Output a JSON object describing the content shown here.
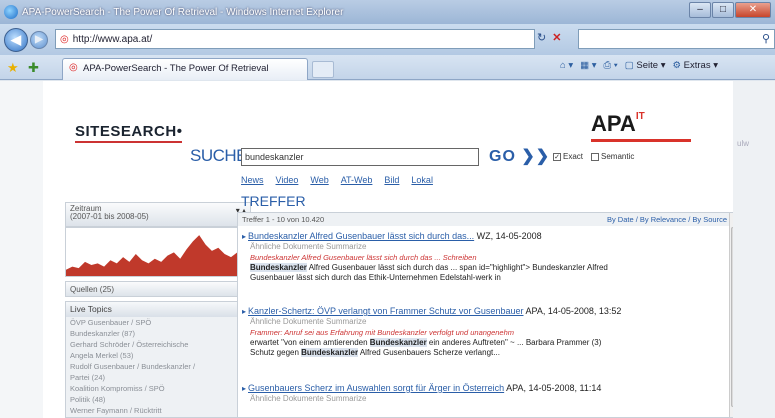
{
  "window": {
    "title": "APA-PowerSearch - The Power Of Retrieval - Windows Internet Explorer",
    "min": "–",
    "max": "□",
    "close": "✕"
  },
  "address": {
    "url": "http://www.apa.at/",
    "refresh_icon": "↻",
    "stop_icon": "✕"
  },
  "tabs": {
    "active_label": "APA-PowerSearch - The Power Of Retrieval"
  },
  "command_bar": {
    "page_label": "Seite",
    "extras_label": "Extras"
  },
  "page": {
    "logo_left": "SITESEARCH",
    "logo_right": "APA",
    "logo_right_sup": "IT",
    "side_label": "ulw"
  },
  "search": {
    "label": "SUCHE",
    "query": "bundeskanzler",
    "go_label": "GO",
    "go_arrows": "❯❯",
    "opt_exact": "Exact",
    "opt_semantic": "Semantic",
    "exact_checked": "✓"
  },
  "subnav": [
    "News",
    "Video",
    "Web",
    "AT-Web",
    "Bild",
    "Lokal"
  ],
  "filters": {
    "zeitraum": "Zeitraum",
    "zeitraum_range": "(2007-01 bis 2008-05)",
    "quellen": "Quellen (25)",
    "live_topics": "Live Topics",
    "topics": [
      "ÖVP Gusenbauer / SPÖ",
      "Bundeskanzler (87)",
      "Gerhard Schröder / Österreichische",
      "Angela Merkel (53)",
      "Rudolf Gusenbauer / Bundeskanzler /",
      "Partei (24)",
      "Koalition Kompromiss / SPÖ",
      "Politik (48)",
      "Werner Faymann / Rücktritt"
    ],
    "chart_series": [
      4,
      6,
      5,
      9,
      7,
      8,
      6,
      10,
      8,
      12,
      9,
      14,
      10,
      8,
      11,
      9,
      13,
      15,
      11,
      17,
      22,
      26,
      20,
      16,
      18,
      14,
      12,
      15,
      13,
      16
    ]
  },
  "results": {
    "heading": "TREFFER",
    "count_label": "Treffer 1 - 10 von 10.420",
    "sort_label": "By Date / By Relevance / By Source",
    "items": [
      {
        "title": "Bundeskanzler Alfred Gusenbauer lässt sich durch das...",
        "meta": "WZ, 14-05-2008",
        "sub": "Ähnliche Dokumente   Summarize",
        "red": "Bundeskanzler Alfred Gusenbauer lässt sich durch das ... Schreiben",
        "text_hl": "Bundeskanzler",
        "text": " Alfred Gusenbauer lässt sich durch das ... span id=\"highlight\"> Bundeskanzler Alfred",
        "text2": "Gusenbauer lässt sich durch das Ethik-Unternehmen Edelstahl-werk in"
      },
      {
        "title": "Kanzler-Schertz: ÖVP verlangt von Frammer Schutz vor Gusenbauer",
        "meta": "APA, 14-05-2008, 13:52",
        "sub": "Ähnliche Dokumente   Summarize",
        "red": "Frammer: Anruf sei aus Erfahrung mit Bundeskanzler verfolgt und unangenehm",
        "text_pre": "erwartet \"von einem amtierenden ",
        "text_hl": "Bundeskanzler",
        "text": " ein anderes Auftreten\" ~ ... Barbara Prammer (3)",
        "text2_pre": "Schutz gegen ",
        "text2_hl": "Bundeskanzler",
        "text2": " Alfred Gusenbauers Scherze verlangt..."
      },
      {
        "title": "Gusenbauers Scherz im Auswahlen sorgt für Ärger in Österreich",
        "meta": "APA, 14-05-2008, 11:14",
        "sub": "Ähnliche Dokumente   Summarize"
      }
    ]
  }
}
